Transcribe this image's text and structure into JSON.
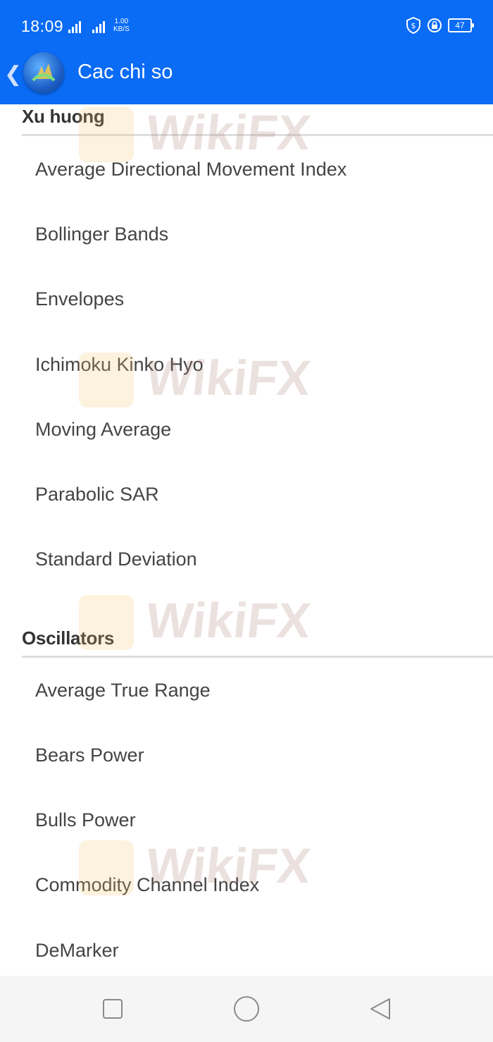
{
  "status_bar": {
    "time": "18:09",
    "net_speed_value": "1.00",
    "net_speed_unit": "KB/S",
    "battery_level": "47"
  },
  "app_bar": {
    "title": "Cac chi so"
  },
  "sections": [
    {
      "title": "Xu huong",
      "items": [
        "Average Directional Movement Index",
        "Bollinger Bands",
        "Envelopes",
        "Ichimoku Kinko Hyo",
        "Moving Average",
        "Parabolic SAR",
        "Standard Deviation"
      ]
    },
    {
      "title": "Oscillators",
      "items": [
        "Average True Range",
        "Bears Power",
        "Bulls Power",
        "Commodity Channel Index",
        "DeMarker"
      ]
    }
  ],
  "watermark": {
    "text": "WikiFX"
  },
  "colors": {
    "accent": "#0a6bf5",
    "section_text": "#333333",
    "item_text": "#444444",
    "divider": "#dedede"
  },
  "icons": [
    "back-chevron-icon",
    "metatrader-logo-icon",
    "shield-icon",
    "lock-icon",
    "battery-icon",
    "recent-apps-icon",
    "home-icon",
    "back-icon"
  ]
}
